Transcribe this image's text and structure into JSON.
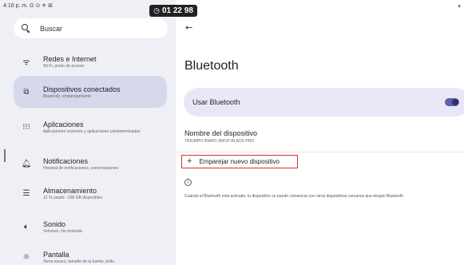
{
  "status_bar": {
    "time": "4:16 p. m. G ⊙ ✈ ⊞"
  },
  "timer": {
    "icon": "clock-icon",
    "value": "01 22 98"
  },
  "search": {
    "placeholder": "Buscar"
  },
  "sidebar": {
    "items": [
      {
        "icon": "wifi-icon",
        "title": "Redes e Internet",
        "subtitle": "Wi-Fi, punto de acceso",
        "active": false
      },
      {
        "icon": "devices-icon",
        "title": "Dispositivos conectados",
        "subtitle": "Bluetooth, emparejamiento",
        "active": true
      },
      {
        "icon": "apps-icon",
        "title": "Aplicaciones",
        "subtitle": "Aplicaciones recientes y aplicaciones predeterminadas",
        "active": false
      },
      {
        "icon": "bell-icon",
        "title": "Notificaciones",
        "subtitle": "Historial de notificaciones, conversaciones",
        "active": false
      },
      {
        "icon": "storage-icon",
        "title": "Almacenamiento",
        "subtitle": "12 % usado - 228 GB disponibles",
        "active": false
      },
      {
        "icon": "volume-icon",
        "title": "Sonido",
        "subtitle": "Volumen, No molestar",
        "active": false
      },
      {
        "icon": "display-icon",
        "title": "Pantalla",
        "subtitle": "Tema oscuro, tamaño de la fuente, brillo",
        "active": false
      }
    ]
  },
  "main": {
    "title": "Bluetooth",
    "use_bluetooth": {
      "label": "Usar Bluetooth",
      "enabled": true
    },
    "device_name": {
      "title": "Nombre del dispositivo",
      "value": "TRIUMPH-30ARC-9941P-BLACK-PRO"
    },
    "pair_new": {
      "label": "Emparejar nuevo dispositivo"
    },
    "info_text": "Cuando el Bluetooth está activado, tu dispositivo se puede comunicar con otros dispositivos cercanos que tengan Bluetooth"
  },
  "colors": {
    "sidebar_bg": "#eef0f6",
    "active_item": "#d6d9ec",
    "toggle_card": "#e9e7f7",
    "toggle_on": "#5b5fa5",
    "highlight_border": "#d3302f"
  }
}
